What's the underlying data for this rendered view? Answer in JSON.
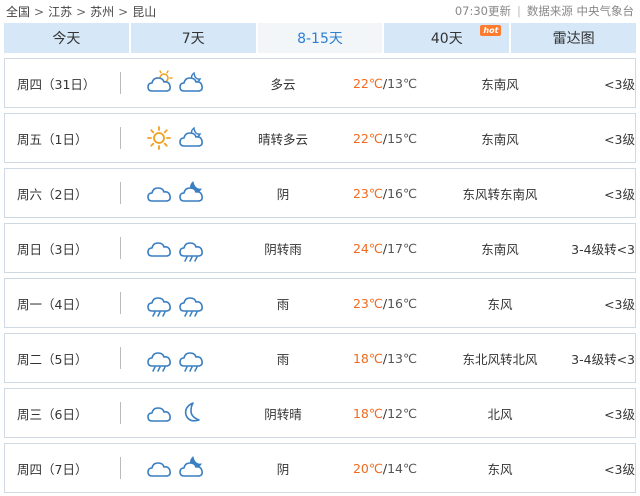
{
  "breadcrumb": {
    "items": [
      "全国",
      "江苏",
      "苏州",
      "昆山"
    ],
    "separator": ">"
  },
  "meta": {
    "update_time": "07:30更新",
    "source": "数据来源 中央气象台"
  },
  "tabs": [
    {
      "label": "今天",
      "active": false
    },
    {
      "label": "7天",
      "active": false
    },
    {
      "label": "8-15天",
      "active": true
    },
    {
      "label": "40天",
      "active": false,
      "badge": "hot"
    },
    {
      "label": "雷达图",
      "active": false
    }
  ],
  "colors": {
    "tab_bg": "#d6e8f7",
    "tab_active_text": "#2c7fd3",
    "high_temp": "#f06a1f",
    "icon_stroke": "#3a7fc1",
    "sun": "#f0a020"
  },
  "forecast": [
    {
      "day": "周四（31日）",
      "icon_day": "partly-cloudy-icon",
      "icon_night": "cloudy-night-icon",
      "desc": "多云",
      "high": "22℃",
      "low": "13℃",
      "wind": "东南风",
      "level": "<3级"
    },
    {
      "day": "周五（1日）",
      "icon_day": "sunny-icon",
      "icon_night": "cloudy-night-icon",
      "desc": "晴转多云",
      "high": "22℃",
      "low": "15℃",
      "wind": "东南风",
      "level": "<3级"
    },
    {
      "day": "周六（2日）",
      "icon_day": "overcast-icon",
      "icon_night": "cloudy-moon-icon",
      "desc": "阴",
      "high": "23℃",
      "low": "16℃",
      "wind": "东风转东南风",
      "level": "<3级"
    },
    {
      "day": "周日（3日）",
      "icon_day": "overcast-icon",
      "icon_night": "rain-icon",
      "desc": "阴转雨",
      "high": "24℃",
      "low": "17℃",
      "wind": "东南风",
      "level": "3-4级转<3"
    },
    {
      "day": "周一（4日）",
      "icon_day": "rain-icon",
      "icon_night": "rain-icon",
      "desc": "雨",
      "high": "23℃",
      "low": "16℃",
      "wind": "东风",
      "level": "<3级"
    },
    {
      "day": "周二（5日）",
      "icon_day": "rain-icon",
      "icon_night": "rain-icon",
      "desc": "雨",
      "high": "18℃",
      "low": "13℃",
      "wind": "东北风转北风",
      "level": "3-4级转<3"
    },
    {
      "day": "周三（6日）",
      "icon_day": "overcast-icon",
      "icon_night": "moon-icon",
      "desc": "阴转晴",
      "high": "18℃",
      "low": "12℃",
      "wind": "北风",
      "level": "<3级"
    },
    {
      "day": "周四（7日）",
      "icon_day": "overcast-icon",
      "icon_night": "cloudy-moon-icon",
      "desc": "阴",
      "high": "20℃",
      "low": "14℃",
      "wind": "东风",
      "level": "<3级"
    }
  ]
}
